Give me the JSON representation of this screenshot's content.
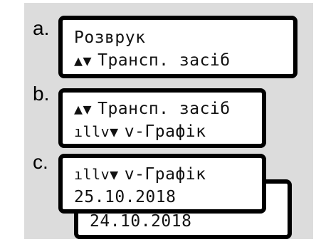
{
  "markers": {
    "a": "a.",
    "b": "b.",
    "c": "c."
  },
  "screen_a": {
    "line1": "Розврук",
    "line2_icon": "▲▼",
    "line2_text": "Трансп. засіб"
  },
  "screen_b": {
    "line1_icon": "▲▼",
    "line1_text": "Трансп. засіб",
    "line2_icon": "ıllv▼",
    "line2_text": "v-Графік"
  },
  "screen_c": {
    "line1_icon": "ıllv▼",
    "line1_text": "v-Графік",
    "line2": "25.10.2018",
    "back_line": "24.10.2018"
  }
}
